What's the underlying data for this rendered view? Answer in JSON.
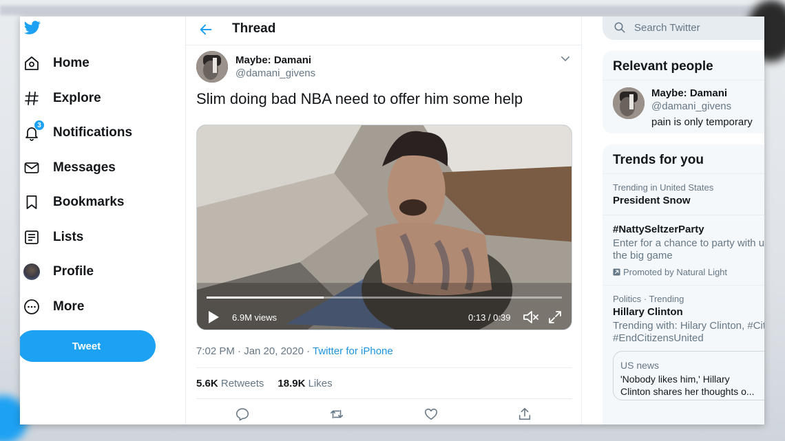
{
  "nav": {
    "items": [
      {
        "label": "Home",
        "icon": "home-icon"
      },
      {
        "label": "Explore",
        "icon": "hashtag-icon"
      },
      {
        "label": "Notifications",
        "icon": "bell-icon",
        "badge": "3"
      },
      {
        "label": "Messages",
        "icon": "envelope-icon"
      },
      {
        "label": "Bookmarks",
        "icon": "bookmark-icon"
      },
      {
        "label": "Lists",
        "icon": "list-icon"
      },
      {
        "label": "Profile",
        "icon": "avatar"
      },
      {
        "label": "More",
        "icon": "more-icon"
      }
    ],
    "tweet_button": "Tweet",
    "brand_color": "#1da1f2"
  },
  "main": {
    "title": "Thread",
    "tweet": {
      "name": "Maybe: Damani",
      "handle": "@damani_givens",
      "text": "Slim doing bad NBA need to offer him some help",
      "video": {
        "views": "6.9M views",
        "timecode": "0:13 / 0:39",
        "progress": 0.33
      },
      "time": "7:02 PM · Jan 20, 2020 · ",
      "source": "Twitter for iPhone",
      "retweets_count": "5.6K",
      "retweets_label": "Retweets",
      "likes_count": "18.9K",
      "likes_label": "Likes"
    }
  },
  "right": {
    "search_placeholder": "Search Twitter",
    "relevant": {
      "title": "Relevant people",
      "name": "Maybe: Damani",
      "handle": "@damani_givens",
      "bio": "pain is only temporary"
    },
    "trends": {
      "title": "Trends for you",
      "items": [
        {
          "context": "Trending in United States",
          "name": "President Snow"
        },
        {
          "name": "#NattySeltzerParty",
          "desc1": "Enter for a chance to party with us",
          "desc2": "the big game",
          "promoted": "Promoted by Natural Light"
        },
        {
          "context": "Politics · Trending",
          "name": "Hillary Clinton",
          "desc1": "Trending with: Hilary Clinton, #Citiz",
          "desc2": "#EndCitizensUnited"
        }
      ],
      "news": {
        "category": "US news",
        "line1": "'Nobody likes him,' Hillary",
        "line2": "Clinton shares her thoughts o..."
      }
    }
  }
}
